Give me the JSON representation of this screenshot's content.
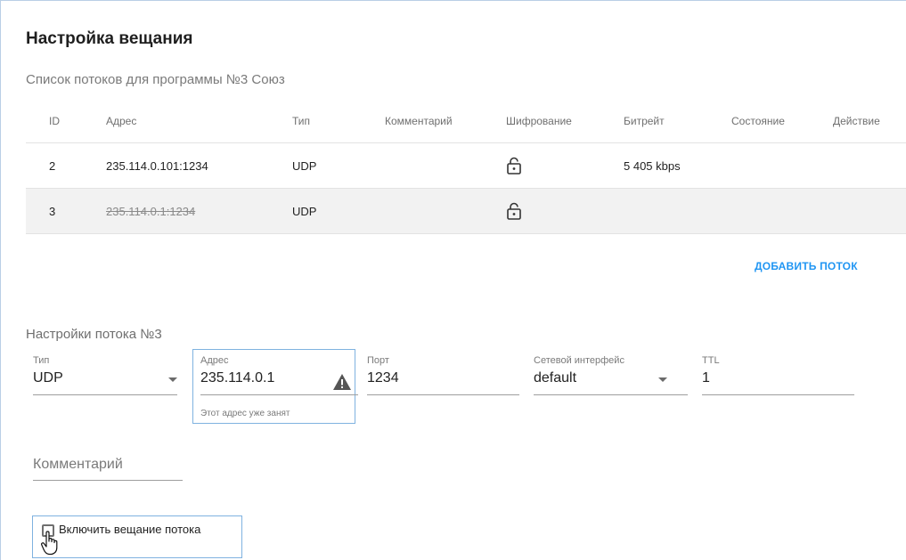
{
  "page": {
    "title": "Настройка вещания",
    "list_title": "Список потоков для программы №3 Союз"
  },
  "table": {
    "headers": {
      "id": "ID",
      "address": "Адрес",
      "type": "Тип",
      "comment": "Комментарий",
      "encryption": "Шифрование",
      "bitrate": "Битрейт",
      "state": "Состояние",
      "action": "Действие"
    },
    "rows": [
      {
        "id": "2",
        "address": "235.114.0.101:1234",
        "type": "UDP",
        "comment": "",
        "encryption_icon": "unlocked-icon",
        "bitrate": "5 405 kbps",
        "state": "",
        "action": "",
        "disabled": false
      },
      {
        "id": "3",
        "address": "235.114.0.1:1234",
        "type": "UDP",
        "comment": "",
        "encryption_icon": "unlocked-icon",
        "bitrate": "",
        "state": "",
        "action": "",
        "disabled": true
      }
    ]
  },
  "add_stream_label": "ДОБАВИТЬ ПОТОК",
  "stream_settings": {
    "title": "Настройки потока №3",
    "type": {
      "label": "Тип",
      "value": "UDP"
    },
    "address": {
      "label": "Адрес",
      "value": "235.114.0.1",
      "helper": "Этот адрес уже занят"
    },
    "port": {
      "label": "Порт",
      "value": "1234"
    },
    "interface": {
      "label": "Сетевой интерфейс",
      "value": "default"
    },
    "ttl": {
      "label": "TTL",
      "value": "1"
    },
    "comment": {
      "placeholder": "Комментарий"
    },
    "enable": {
      "label": "Включить вещание потока",
      "checked": false
    }
  },
  "colors": {
    "accent": "#2196f3",
    "focus_border": "#7fb2e0",
    "row_alt": "#f2f2f2",
    "warning": "#555555"
  }
}
